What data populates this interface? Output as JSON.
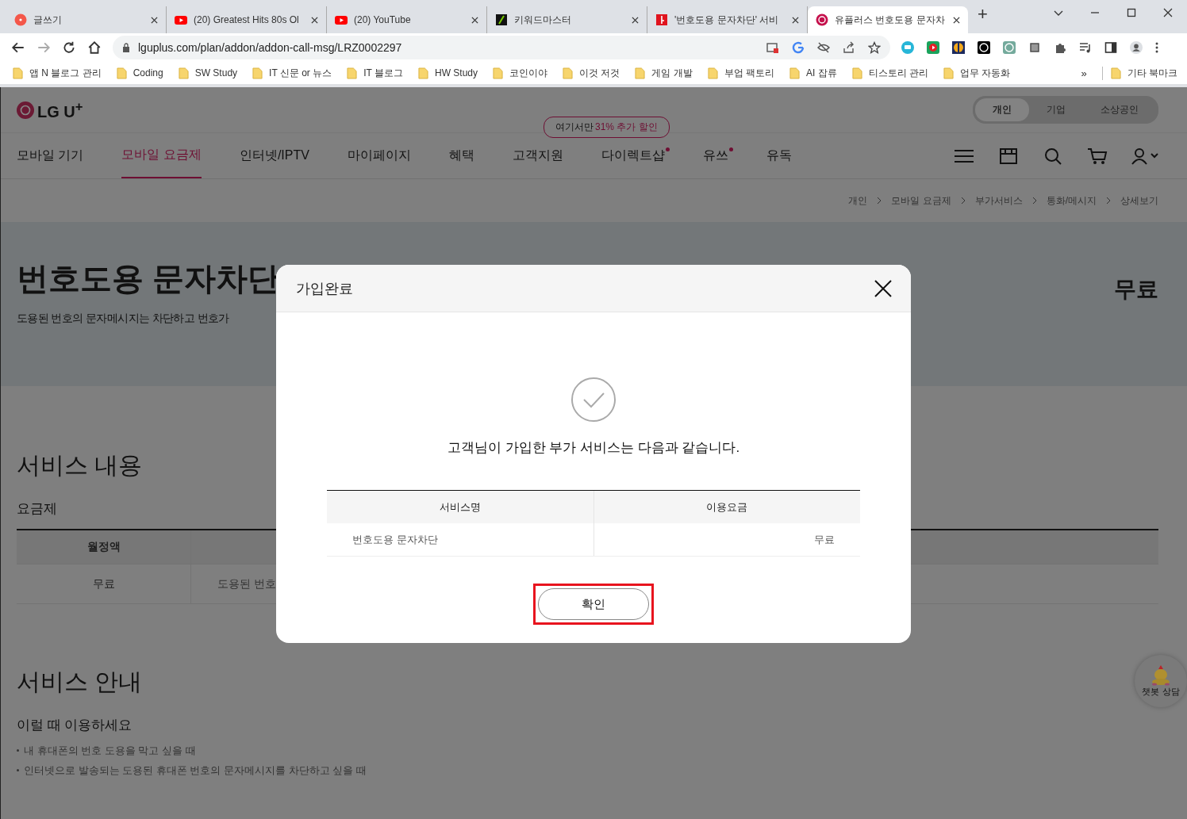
{
  "browser": {
    "tabs": [
      {
        "title": "글쓰기",
        "kind": "dot",
        "selected": false
      },
      {
        "title": "(20) Greatest Hits 80s Ol",
        "kind": "video",
        "selected": false
      },
      {
        "title": "(20) YouTube",
        "kind": "video",
        "selected": false
      },
      {
        "title": "키워드마스터",
        "kind": "keyword",
        "selected": false
      },
      {
        "title": "'번호도용 문자차단' 서비",
        "kind": "key",
        "selected": false
      },
      {
        "title": "유플러스 번호도용 문자차",
        "kind": "brand",
        "selected": true
      }
    ],
    "new_tab": "+",
    "address": "lguplus.com/plan/addon/addon-call-msg/LRZ0002297",
    "bookmarks": [
      "앱 N 블로그 관리",
      "Coding",
      "SW Study",
      "IT 신문 or 뉴스",
      "IT 블로그",
      "HW Study",
      "코인이야",
      "이것 저것",
      "게임 개발",
      "부업 팩토리",
      "AI 잡류",
      "티스토리 관리",
      "업무 자동화"
    ],
    "more": "»",
    "other_bookmarks": "기타 북마크"
  },
  "page": {
    "logo": "LG U$^{+}$",
    "segments": [
      {
        "label": "개인",
        "selected": true
      },
      {
        "label": "기업",
        "selected": false
      },
      {
        "label": "소상공인",
        "selected": false
      }
    ],
    "promo": {
      "text": "여기서만",
      "highlight": "31% 추가 할인"
    },
    "nav": [
      {
        "label": "모바일 기기",
        "selected": false,
        "dot": false
      },
      {
        "label": "모바일 요금제",
        "selected": true,
        "dot": false
      },
      {
        "label": "인터넷/IPTV",
        "selected": false,
        "dot": false
      },
      {
        "label": "마이페이지",
        "selected": false,
        "dot": false
      },
      {
        "label": "혜택",
        "selected": false,
        "dot": false
      },
      {
        "label": "고객지원",
        "selected": false,
        "dot": false
      },
      {
        "label": "다이렉트샵",
        "selected": false,
        "dot": true
      },
      {
        "label": "유쓰",
        "selected": false,
        "dot": true
      },
      {
        "label": "유독",
        "selected": false,
        "dot": false
      }
    ],
    "breadcrumb": [
      "개인",
      "모바일 요금제",
      "부가서비스",
      "통화/메시지",
      "상세보기"
    ],
    "hero": {
      "title": "번호도용 문자차단",
      "description": "도용된 번호의 문자메시지는 차단하고 번호가",
      "price": "무료"
    },
    "service": {
      "heading": "서비스 내용",
      "subheading": "요금제",
      "columns": [
        "월정액"
      ],
      "row": [
        "무료",
        "도용된 번호"
      ]
    },
    "guide": {
      "heading": "서비스 안내",
      "subheading": "이럴 때 이용하세요",
      "bullets": [
        "내 휴대폰의 번호 도용을 막고 싶을 때",
        "인터넷으로 발송되는 도용된 휴대폰 번호의 문자메시지를 차단하고 싶을 때"
      ]
    },
    "chatbot": "챗봇 상담"
  },
  "modal": {
    "title": "가입완료",
    "message": "고객님이 가입한 부가 서비스는 다음과 같습니다.",
    "columns": [
      "서비스명",
      "이용요금"
    ],
    "rows": [
      [
        "번호도용 문자차단",
        "무료"
      ]
    ],
    "confirm": "확인",
    "highlighted": true
  }
}
